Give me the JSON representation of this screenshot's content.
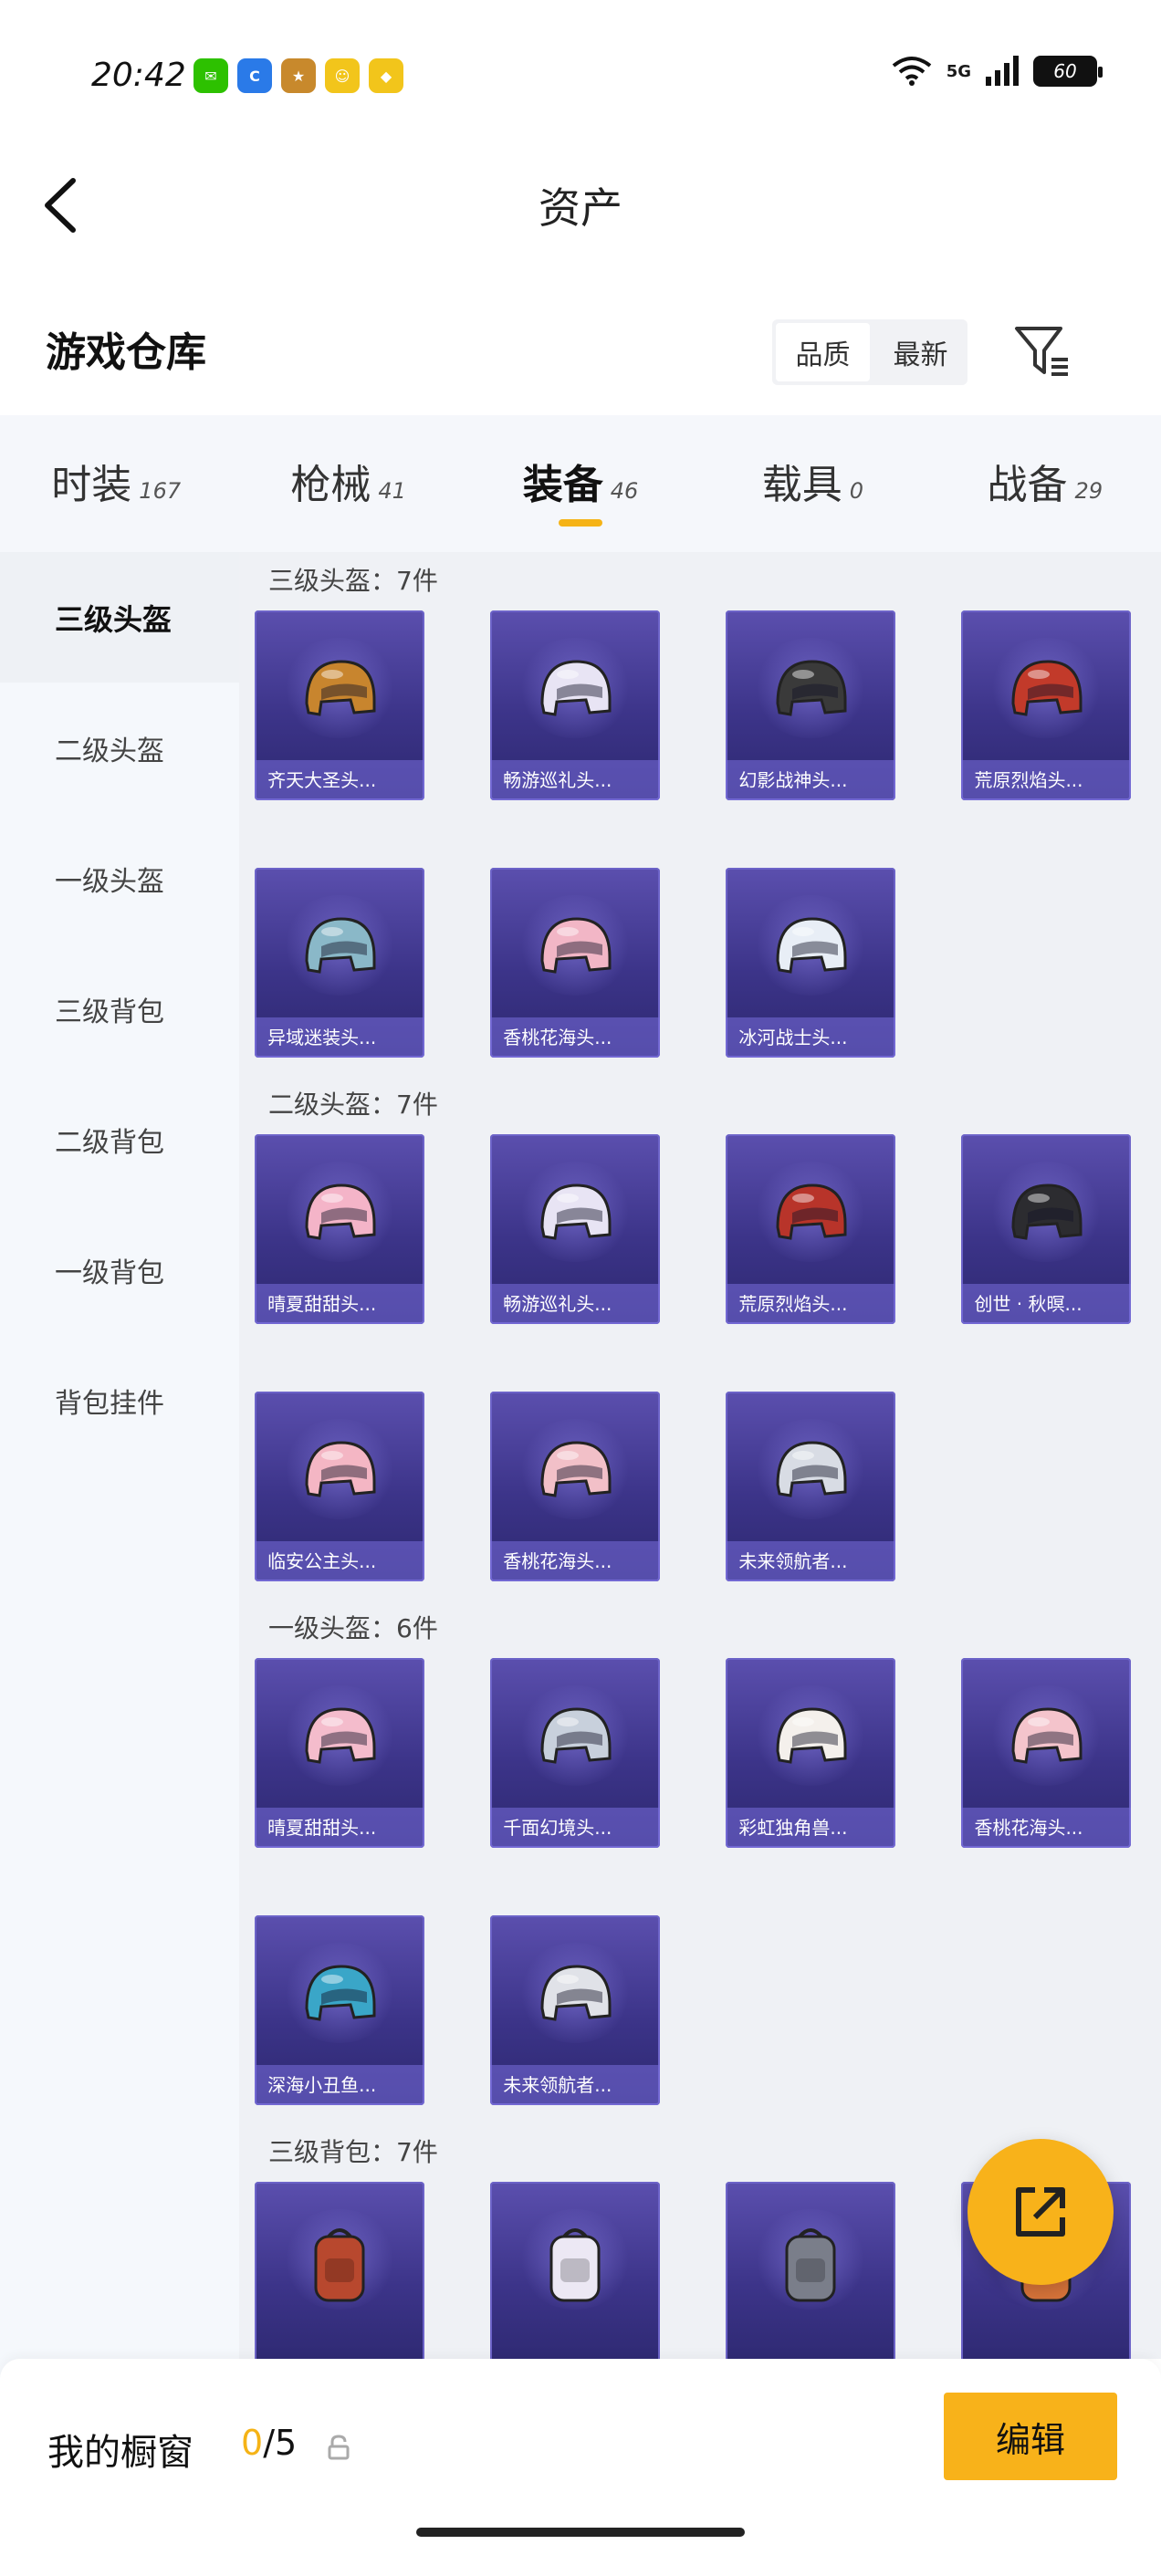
{
  "status": {
    "time": "20:42",
    "network": "5G",
    "battery": "60",
    "apps": [
      {
        "icon": "wechat-icon",
        "color": "#2dc100",
        "glyph": "✉"
      },
      {
        "icon": "browser-icon",
        "color": "#2a7ae8",
        "glyph": "C"
      },
      {
        "icon": "game-app-icon",
        "color": "#c8892c",
        "glyph": "★"
      },
      {
        "icon": "app-icon",
        "color": "#f2c51b",
        "glyph": "☺"
      },
      {
        "icon": "app-icon-2",
        "color": "#f2c51b",
        "glyph": "◆"
      }
    ]
  },
  "nav": {
    "title": "资产"
  },
  "header": {
    "title": "游戏仓库",
    "sort": {
      "options": [
        "品质",
        "最新"
      ],
      "active": 0
    }
  },
  "tabs": [
    {
      "label": "时装",
      "count": "167"
    },
    {
      "label": "枪械",
      "count": "41"
    },
    {
      "label": "装备",
      "count": "46",
      "active": true
    },
    {
      "label": "载具",
      "count": "0"
    },
    {
      "label": "战备",
      "count": "29"
    }
  ],
  "sidebar": [
    {
      "label": "三级头盔",
      "active": true
    },
    {
      "label": "二级头盔"
    },
    {
      "label": "一级头盔"
    },
    {
      "label": "三级背包"
    },
    {
      "label": "二级背包"
    },
    {
      "label": "一级背包"
    },
    {
      "label": "背包挂件"
    }
  ],
  "groups": [
    {
      "label": "三级头盔：7件",
      "items": [
        {
          "name": "齐天大圣头...",
          "color": "#c8852e"
        },
        {
          "name": "畅游巡礼头...",
          "color": "#e8e4f4"
        },
        {
          "name": "幻影战神头...",
          "color": "#3a3a3a"
        },
        {
          "name": "荒原烈焰头...",
          "color": "#c23a2a"
        },
        {
          "name": "异域迷装头...",
          "color": "#8ab8c8"
        },
        {
          "name": "香桃花海头...",
          "color": "#f2b6c6"
        },
        {
          "name": "冰河战士头...",
          "color": "#e8eef6"
        }
      ]
    },
    {
      "label": "二级头盔：7件",
      "items": [
        {
          "name": "晴夏甜甜头...",
          "color": "#f4b4c8"
        },
        {
          "name": "畅游巡礼头...",
          "color": "#e8e4f4"
        },
        {
          "name": "荒原烈焰头...",
          "color": "#b8342a"
        },
        {
          "name": "创世 · 秋暝...",
          "color": "#2c2c30"
        },
        {
          "name": "临安公主头...",
          "color": "#f4b6c4"
        },
        {
          "name": "香桃花海头...",
          "color": "#f2c0c8"
        },
        {
          "name": "未来领航者...",
          "color": "#d8dce4"
        }
      ]
    },
    {
      "label": "一级头盔：6件",
      "items": [
        {
          "name": "晴夏甜甜头...",
          "color": "#f4bccc"
        },
        {
          "name": "千面幻境头...",
          "color": "#c8d0dc"
        },
        {
          "name": "彩虹独角兽...",
          "color": "#f4f0ec"
        },
        {
          "name": "香桃花海头...",
          "color": "#f4c4cc"
        },
        {
          "name": "深海小丑鱼...",
          "color": "#3aa6c8"
        },
        {
          "name": "未来领航者...",
          "color": "#e0e2e8"
        }
      ]
    },
    {
      "label": "三级背包：7件",
      "items": [
        {
          "name": "",
          "color": "#b8482e"
        },
        {
          "name": "",
          "color": "#ece8f4"
        },
        {
          "name": "",
          "color": "#7a7e8a"
        },
        {
          "name": "",
          "color": "#d8743a"
        }
      ]
    }
  ],
  "showcase": {
    "label": "我的橱窗",
    "current": "0",
    "total": "/5"
  },
  "edit_label": "编辑",
  "colors": {
    "accent": "#f8b21a",
    "card": "#3c3489"
  }
}
